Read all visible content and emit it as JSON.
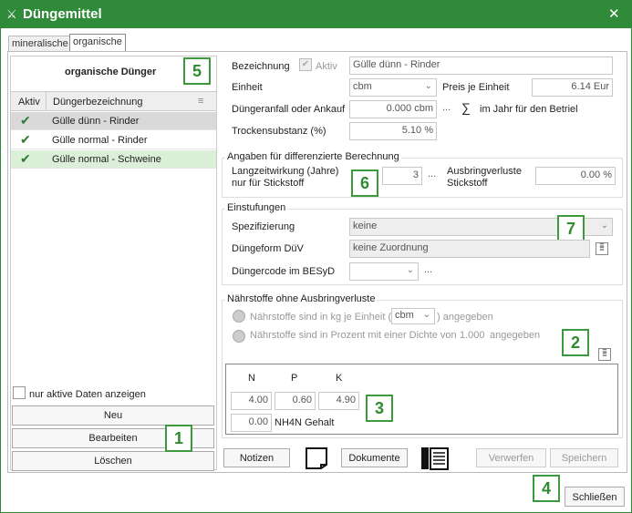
{
  "window": {
    "title": "Düngemittel",
    "close_glyph": "✕"
  },
  "tabs": [
    {
      "label": "mineralische"
    },
    {
      "label": "organische"
    }
  ],
  "left_panel": {
    "header": "organische Dünger",
    "columns": {
      "aktiv": "Aktiv",
      "name": "Düngerbezeichnung"
    },
    "items": [
      {
        "active": true,
        "name": "Gülle dünn - Rinder"
      },
      {
        "active": true,
        "name": "Gülle normal - Rinder"
      },
      {
        "active": true,
        "name": "Gülle normal - Schweine"
      }
    ],
    "checkbox_label": "nur aktive Daten anzeigen",
    "buttons": {
      "new": "Neu",
      "edit": "Bearbeiten",
      "delete": "Löschen"
    }
  },
  "form": {
    "bezeichnung_label": "Bezeichnung",
    "aktiv_label": "Aktiv",
    "bezeichnung_value": "Gülle dünn - Rinder",
    "einheit_label": "Einheit",
    "einheit_value": "cbm",
    "preis_label": "Preis je Einheit",
    "preis_value": "6.14 Eur",
    "anfall_label": "Düngeranfall oder Ankauf",
    "anfall_value": "0.000 cbm",
    "jahr_label": "im Jahr für den Betriel",
    "trocken_label": "Trockensubstanz (%)",
    "trocken_value": "5.10 %",
    "sum_glyph": "∑",
    "dots": "..."
  },
  "diff": {
    "title": "Angaben für differenzierte Berechnung",
    "langzeit_label": "Langzeitwirkung (Jahre) nur für Stickstoff",
    "langzeit_value": "3",
    "verlust_label": "Ausbringverluste Stickstoff",
    "verlust_value": "0.00 %"
  },
  "einstufungen": {
    "title": "Einstufungen",
    "spez_label": "Spezifizierung",
    "spez_value": "keine",
    "form_label": "Düngeform DüV",
    "form_value": "keine Zuordnung",
    "code_label": "Düngercode im BESyD",
    "code_value": ""
  },
  "naehrstoffe": {
    "title": "Nährstoffe ohne Ausbringverluste",
    "opt1_pre": "Nährstoffe sind in kg je Einheit (",
    "opt1_unit": "cbm",
    "opt1_post": ") angegeben",
    "opt2": "Nährstoffe sind in Prozent mit einer Dichte von",
    "opt2_density": "1.000",
    "opt2_post": "angegeben",
    "n_label": "N",
    "p_label": "P",
    "k_label": "K",
    "n_value": "4.00",
    "p_value": "0.60",
    "k_value": "4.90",
    "nh4n_value": "0.00",
    "nh4n_label": "NH4N Gehalt"
  },
  "bottom": {
    "notizen": "Notizen",
    "dokumente": "Dokumente",
    "verwerfen": "Verwerfen",
    "speichern": "Speichern",
    "schliessen": "Schließen"
  },
  "badges": [
    "1",
    "2",
    "3",
    "4",
    "5",
    "6",
    "7"
  ],
  "colors": {
    "titlebar": "#2f8a3a",
    "badge": "#3c9a3c",
    "check": "#2e7d32",
    "selected_row": "#d9d9d9",
    "highlight_row": "#dcefd9"
  }
}
